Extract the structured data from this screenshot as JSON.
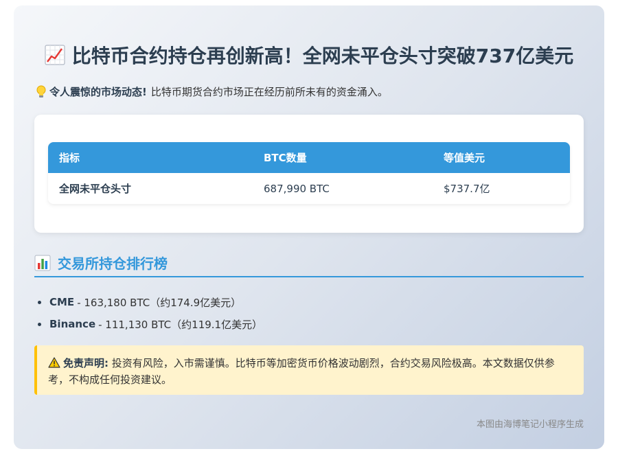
{
  "title": "比特币合约持仓再创新高！全网未平仓头寸突破737亿美元",
  "intro": {
    "label": "令人震惊的市场动态!",
    "text": "比特币期货合约市场正在经历前所未有的资金涌入。"
  },
  "table": {
    "headers": [
      "指标",
      "BTC数量",
      "等值美元"
    ],
    "rows": [
      [
        "全网未平仓头寸",
        "687,990 BTC",
        "$737.7亿"
      ]
    ]
  },
  "ranking": {
    "title": "交易所持仓排行榜",
    "items": [
      {
        "exchange": "CME",
        "detail": "- 163,180 BTC（约174.9亿美元）"
      },
      {
        "exchange": "Binance",
        "detail": "- 111,130 BTC（约119.1亿美元）"
      }
    ]
  },
  "disclaimer": {
    "label": "免责声明:",
    "text": "投资有风险，入市需谨慎。比特币等加密货币价格波动剧烈，合约交易风险极高。本文数据仅供参考，不构成任何投资建议。"
  },
  "footer": "本图由海博笔记小程序生成",
  "icons": {
    "title": "chart-increasing-icon",
    "intro": "light-bulb-icon",
    "ranking": "bar-chart-icon",
    "disclaimer": "warning-icon"
  },
  "colors": {
    "accent": "#3498db",
    "warning_bg": "#fff3cd",
    "warning_border": "#ffc107"
  }
}
